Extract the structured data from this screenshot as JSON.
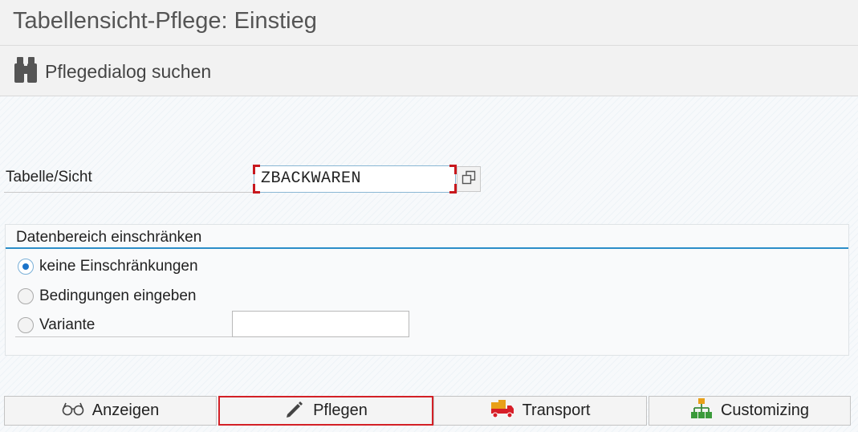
{
  "window": {
    "title": "Tabellensicht-Pflege: Einstieg"
  },
  "toolbar": {
    "find_dialog_label": "Pflegedialog suchen",
    "find_dialog_icon": "binoculars-icon"
  },
  "form": {
    "table_view_label": "Tabelle/Sicht",
    "table_view_value": "ZBACKWAREN"
  },
  "restrict_group": {
    "title": "Datenbereich einschränken",
    "options": [
      {
        "label": "keine Einschränkungen",
        "selected": true
      },
      {
        "label": "Bedingungen eingeben",
        "selected": false
      },
      {
        "label": "Variante",
        "selected": false
      }
    ],
    "variant_value": ""
  },
  "footer": {
    "display_label": "Anzeigen",
    "maintain_label": "Pflegen",
    "transport_label": "Transport",
    "customizing_label": "Customizing"
  },
  "colors": {
    "accent": "#2c8ec8",
    "focus": "#d32026",
    "radio_selected": "#1a73c9"
  }
}
